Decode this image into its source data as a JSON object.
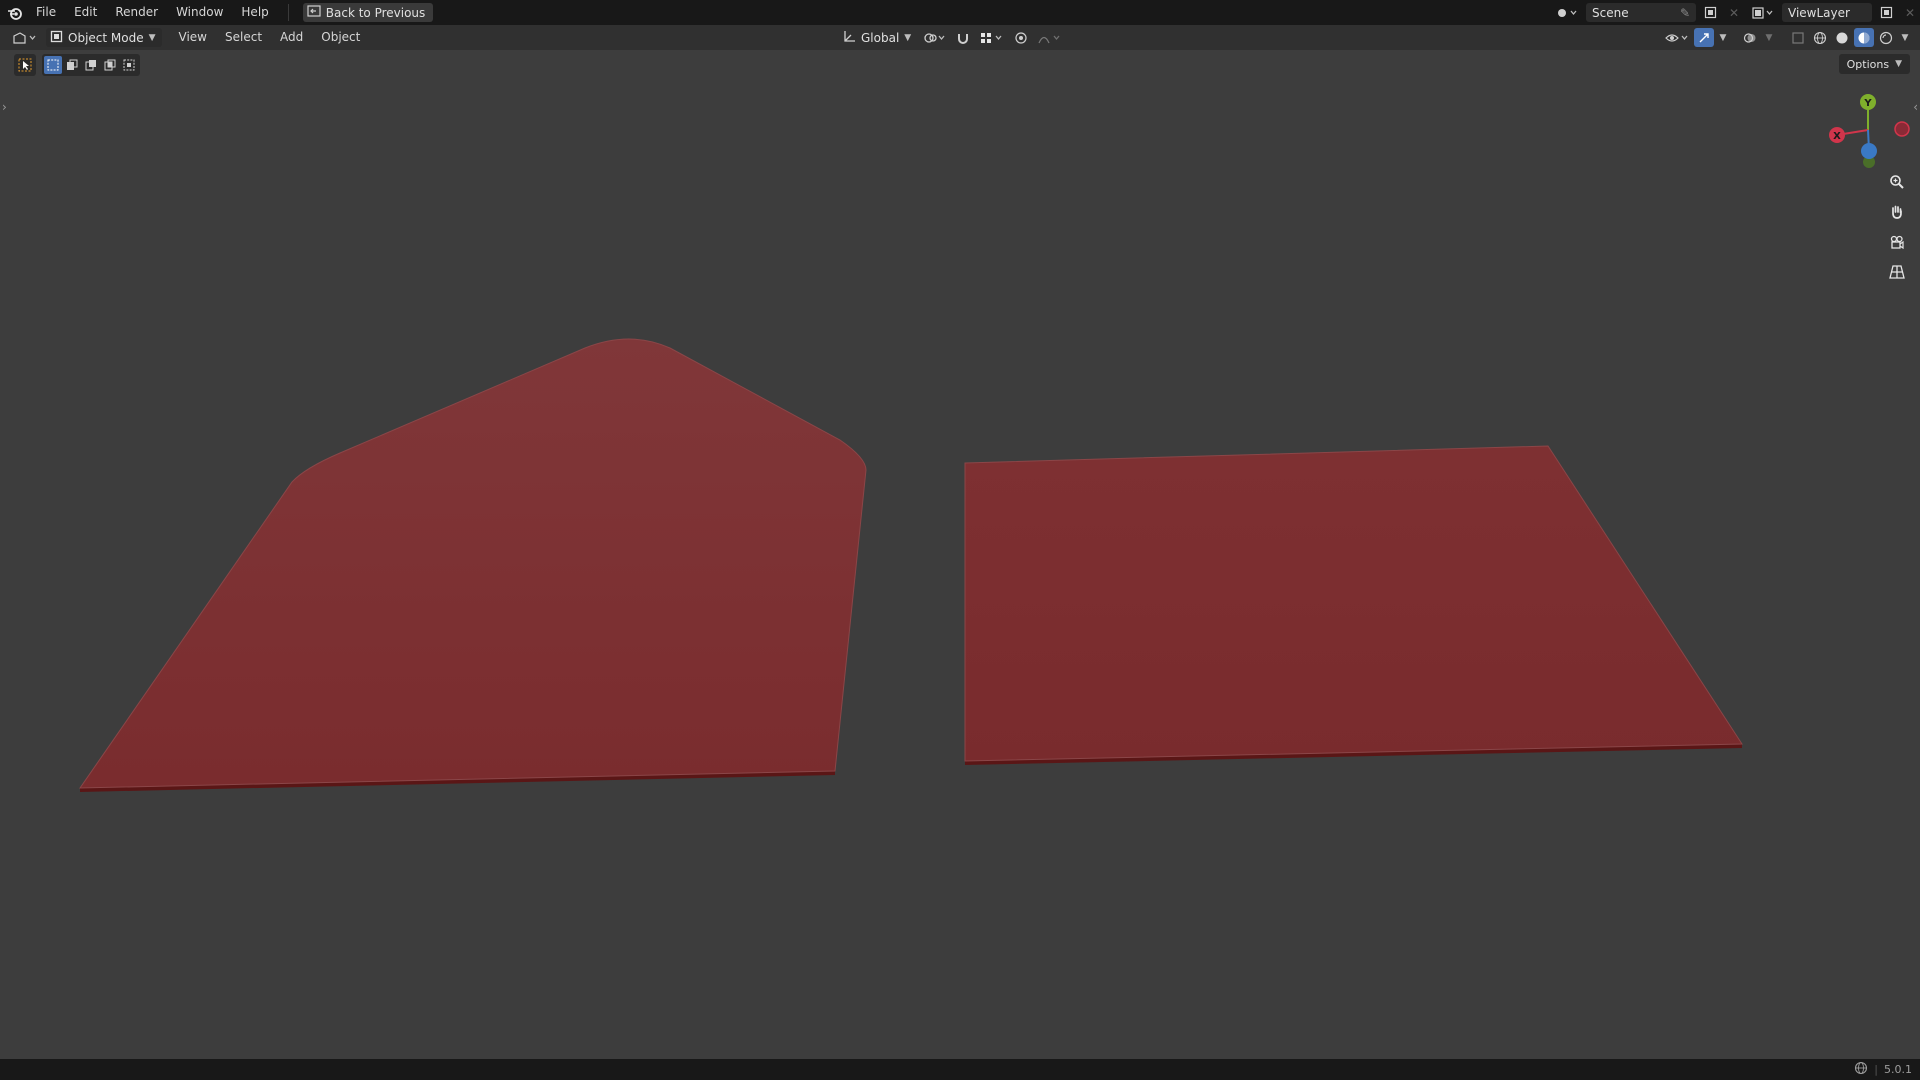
{
  "topbar": {
    "menus": [
      "File",
      "Edit",
      "Render",
      "Window",
      "Help"
    ],
    "back_label": "Back to Previous",
    "scene_name": "Scene",
    "view_layer_name": "ViewLayer"
  },
  "header": {
    "mode_label": "Object Mode",
    "menus": [
      "View",
      "Select",
      "Add",
      "Object"
    ],
    "orientation_label": "Global"
  },
  "viewport": {
    "options_label": "Options",
    "gizmo_axes": [
      "Y",
      "X",
      "Z"
    ],
    "object_color": "#7b2f31",
    "background_color": "#3d3d3d",
    "navigation_buttons": [
      "zoom-icon",
      "pan-hand-icon",
      "camera-icon",
      "perspective-grid-icon"
    ]
  },
  "statusbar": {
    "version": "5.0.1"
  }
}
